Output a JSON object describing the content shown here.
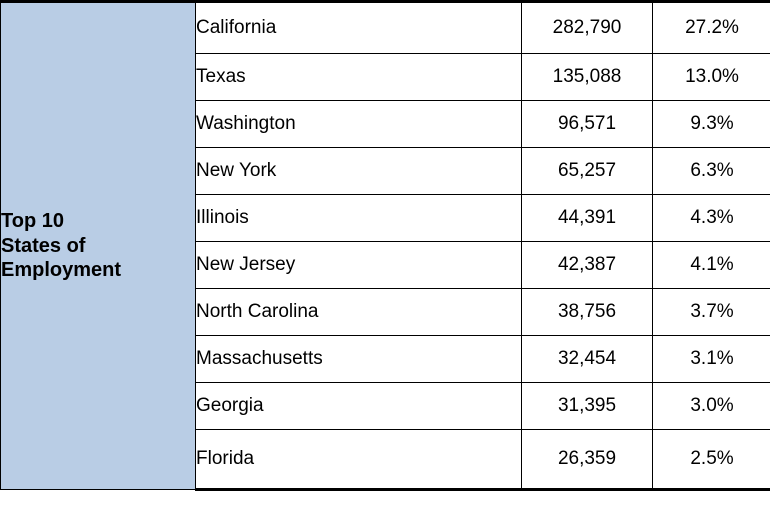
{
  "table": {
    "row_label": "Top 10 States of Employment",
    "row_label_lines": [
      "Top 10",
      "States of",
      "Employment"
    ],
    "rows": [
      {
        "state": "California",
        "count": "282,790",
        "percent": "27.2%"
      },
      {
        "state": "Texas",
        "count": "135,088",
        "percent": "13.0%"
      },
      {
        "state": "Washington",
        "count": "96,571",
        "percent": "9.3%"
      },
      {
        "state": "New York",
        "count": "65,257",
        "percent": "6.3%"
      },
      {
        "state": "Illinois",
        "count": "44,391",
        "percent": "4.3%"
      },
      {
        "state": "New Jersey",
        "count": "42,387",
        "percent": "4.1%"
      },
      {
        "state": "North Carolina",
        "count": "38,756",
        "percent": "3.7%"
      },
      {
        "state": "Massachusetts",
        "count": "32,454",
        "percent": "3.1%"
      },
      {
        "state": "Georgia",
        "count": "31,395",
        "percent": "3.0%"
      },
      {
        "state": "Florida",
        "count": "26,359",
        "percent": "2.5%"
      }
    ],
    "colors": {
      "label_background": "#b9cde5",
      "border": "#000000",
      "text": "#000000"
    }
  }
}
